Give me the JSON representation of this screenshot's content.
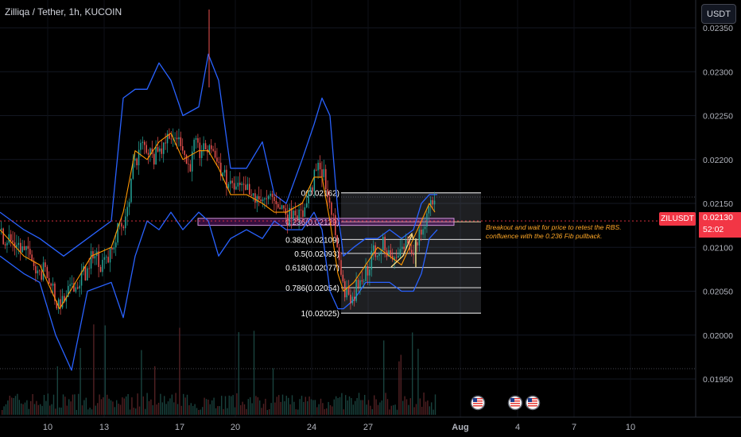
{
  "header": {
    "title": "Zilliqa / Tether, 1h, KUCOIN",
    "currency_label": "USDT"
  },
  "annotation": {
    "line1": "Breakout and wait for price to retest the RBS.",
    "line2": "confluence with the 0.236 Fib pullback."
  },
  "price_tag": {
    "symbol": "ZILUSDT",
    "price": "0.02130",
    "countdown": "52:02"
  },
  "colors": {
    "background": "#000000",
    "up": "#26a69a",
    "down": "#ef5350",
    "bollinger": "#2962ff",
    "ma": "#ff9800",
    "fib_line": "#ffffff",
    "fib_zone": "#787b86",
    "rbs_zone": "#9c27b0",
    "price_line": "#f23645",
    "annotation": "#ffa726"
  },
  "icons": [
    "us-flag-icon",
    "us-flag-icon",
    "us-flag-icon"
  ],
  "chart_data": {
    "type": "candlestick",
    "symbol": "ZILUSDT",
    "exchange": "KUCOIN",
    "timeframe": "1h",
    "y_axis": {
      "ticks": [
        "0.02350",
        "0.02300",
        "0.02250",
        "0.02200",
        "0.02150",
        "0.02100",
        "0.02050",
        "0.02000",
        "0.01950"
      ],
      "range": [
        0.01935,
        0.02365
      ]
    },
    "x_axis": {
      "ticks": [
        "10",
        "13",
        "17",
        "20",
        "24",
        "27",
        "Aug",
        "4",
        "7",
        "10"
      ]
    },
    "current_price": 0.0213,
    "fibonacci": [
      {
        "level": "0",
        "value": 0.02162,
        "label": "0(0.02162)"
      },
      {
        "level": "0.236",
        "value": 0.02129,
        "label": "0.236(0.02129)"
      },
      {
        "level": "0.382",
        "value": 0.02109,
        "label": "0.382(0.02109)"
      },
      {
        "level": "0.5",
        "value": 0.02093,
        "label": "0.5(0.02093)"
      },
      {
        "level": "0.618",
        "value": 0.02077,
        "label": "0.618(0.02077)"
      },
      {
        "level": "0.786",
        "value": 0.02054,
        "label": "0.786(0.02054)"
      },
      {
        "level": "1",
        "value": 0.02025,
        "label": "1(0.02025)"
      }
    ],
    "rbs_zone": [
      0.02125,
      0.02133
    ],
    "series": [
      {
        "name": "Bollinger Upper",
        "x": [
          0,
          30,
          50,
          80,
          110,
          140,
          155,
          170,
          185,
          200,
          215,
          230,
          250,
          262,
          275,
          290,
          310,
          330,
          345,
          360,
          380,
          395,
          405,
          415,
          425,
          432,
          445,
          460,
          475,
          490,
          505,
          520,
          530,
          540,
          550
        ],
        "y": [
          0.0214,
          0.0212,
          0.0211,
          0.0209,
          0.0211,
          0.0213,
          0.0227,
          0.0228,
          0.0228,
          0.0231,
          0.0229,
          0.0225,
          0.0226,
          0.0232,
          0.0229,
          0.0219,
          0.0219,
          0.0222,
          0.0216,
          0.0215,
          0.022,
          0.0224,
          0.0227,
          0.0225,
          0.0214,
          0.0209,
          0.021,
          0.0211,
          0.0211,
          0.0212,
          0.0211,
          0.0212,
          0.0215,
          0.0216,
          0.0216
        ]
      },
      {
        "name": "Bollinger Lower",
        "x": [
          0,
          30,
          50,
          70,
          90,
          110,
          140,
          155,
          170,
          185,
          200,
          215,
          230,
          250,
          262,
          275,
          290,
          310,
          330,
          345,
          360,
          380,
          395,
          405,
          415,
          425,
          432,
          445,
          460,
          475,
          490,
          505,
          520,
          530,
          540,
          550
        ],
        "y": [
          0.0209,
          0.0207,
          0.0206,
          0.02,
          0.0196,
          0.0205,
          0.0206,
          0.0202,
          0.0209,
          0.0213,
          0.0212,
          0.0214,
          0.0212,
          0.0214,
          0.0213,
          0.0209,
          0.0211,
          0.0212,
          0.0211,
          0.0213,
          0.0212,
          0.0212,
          0.0214,
          0.0212,
          0.0205,
          0.0203,
          0.0203,
          0.0204,
          0.0206,
          0.0206,
          0.0206,
          0.0205,
          0.0205,
          0.0207,
          0.0211,
          0.0212
        ]
      },
      {
        "name": "MA",
        "x": [
          0,
          30,
          50,
          75,
          95,
          115,
          140,
          155,
          170,
          185,
          200,
          215,
          230,
          250,
          262,
          275,
          290,
          310,
          330,
          345,
          360,
          380,
          395,
          405,
          415,
          425,
          432,
          445,
          460,
          475,
          490,
          505,
          520,
          530,
          540,
          547
        ],
        "y": [
          0.0212,
          0.0209,
          0.0208,
          0.0203,
          0.0206,
          0.0209,
          0.021,
          0.0214,
          0.0221,
          0.022,
          0.0222,
          0.0223,
          0.022,
          0.0221,
          0.0221,
          0.0219,
          0.0216,
          0.0216,
          0.0215,
          0.0214,
          0.0214,
          0.0215,
          0.0218,
          0.0218,
          0.0213,
          0.0207,
          0.0205,
          0.0206,
          0.0208,
          0.021,
          0.0209,
          0.0208,
          0.0211,
          0.0213,
          0.0215,
          0.0214
        ]
      }
    ]
  }
}
